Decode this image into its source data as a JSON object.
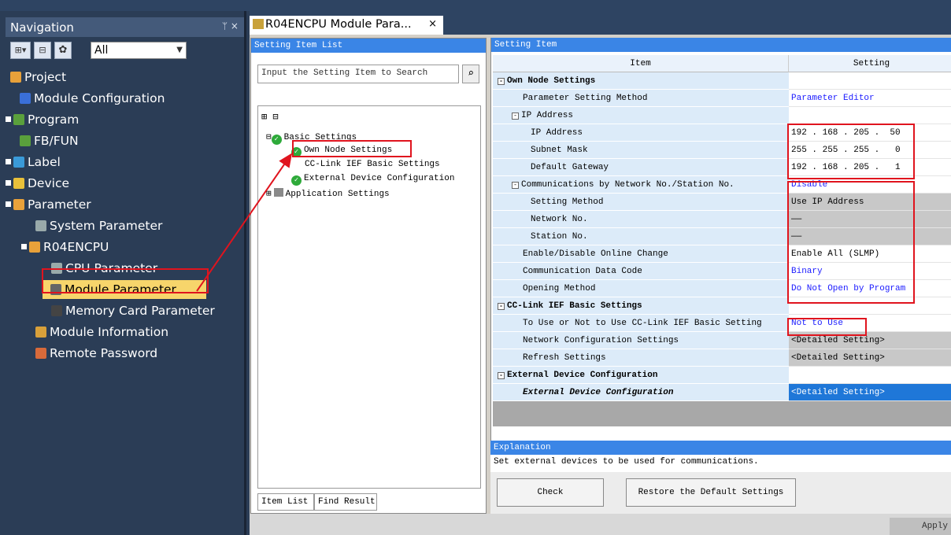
{
  "navigation": {
    "title": "Navigation",
    "pin": "ᛘ ×",
    "filter_value": "All",
    "items": [
      {
        "label": "Project",
        "color": "#e8a13a"
      },
      {
        "label": "Module Configuration",
        "color": "#3a6fd8"
      },
      {
        "label": "Program",
        "color": "#5aa03c"
      },
      {
        "label": "FB/FUN",
        "color": "#5aa03c"
      },
      {
        "label": "Label",
        "color": "#3a9ad8"
      },
      {
        "label": "Device",
        "color": "#e8c03a"
      },
      {
        "label": "Parameter",
        "color": "#e8a13a"
      },
      {
        "label": "System Parameter",
        "color": "#9aa"
      },
      {
        "label": "R04ENCPU",
        "color": "#e8a13a"
      },
      {
        "label": "CPU Parameter",
        "color": "#9aa"
      },
      {
        "label": "Module Parameter",
        "color": "#666"
      },
      {
        "label": "Memory Card Parameter",
        "color": "#444"
      },
      {
        "label": "Module Information",
        "color": "#d8a03a"
      },
      {
        "label": "Remote Password",
        "color": "#d86a3a"
      }
    ]
  },
  "tab": {
    "label": "R04ENCPU Module Para...",
    "close": "×"
  },
  "setting_list": {
    "title": "Setting Item List",
    "search_placeholder": "Input the Setting Item to Search",
    "tree": {
      "basic": "Basic Settings",
      "own_node": "Own Node Settings",
      "cclink": "CC-Link IEF Basic Settings",
      "external": "External Device Configuration",
      "application": "Application Settings"
    },
    "tabs": [
      "Item List",
      "Find Result"
    ]
  },
  "setting_item": {
    "title": "Setting Item",
    "col_item": "Item",
    "col_setting": "Setting",
    "rows": [
      {
        "item": "Own Node Settings",
        "setting": ""
      },
      {
        "item": "Parameter Setting Method",
        "setting": "Parameter Editor"
      },
      {
        "item": "IP Address",
        "setting": ""
      },
      {
        "item": "IP Address",
        "setting": "192 . 168 . 205 .  50"
      },
      {
        "item": "Subnet Mask",
        "setting": "255 . 255 . 255 .   0"
      },
      {
        "item": "Default Gateway",
        "setting": "192 . 168 . 205 .   1"
      },
      {
        "item": "Communications by Network No./Station No.",
        "setting": "Disable"
      },
      {
        "item": "Setting Method",
        "setting": "Use IP Address"
      },
      {
        "item": "Network No.",
        "setting": "——"
      },
      {
        "item": "Station No.",
        "setting": "——"
      },
      {
        "item": "Enable/Disable Online Change",
        "setting": "Enable All (SLMP)"
      },
      {
        "item": "Communication Data Code",
        "setting": "Binary"
      },
      {
        "item": "Opening Method",
        "setting": "Do Not Open by Program"
      },
      {
        "item": "CC-Link IEF Basic Settings",
        "setting": ""
      },
      {
        "item": "To Use or Not to Use CC-Link IEF Basic Setting",
        "setting": "Not to Use"
      },
      {
        "item": "Network Configuration Settings",
        "setting": "<Detailed Setting>"
      },
      {
        "item": "Refresh Settings",
        "setting": "<Detailed Setting>"
      },
      {
        "item": "External Device Configuration",
        "setting": ""
      },
      {
        "item": "External Device Configuration",
        "setting": "<Detailed Setting>"
      }
    ]
  },
  "explanation": {
    "title": "Explanation",
    "text": "Set external devices to be used for communications."
  },
  "buttons": {
    "check": "Check",
    "restore": "Restore the Default Settings",
    "apply": "Apply"
  },
  "colors": {
    "accent": "#3a85e6",
    "highlight": "#e0141e",
    "selected_nav": "#f7d56b"
  }
}
